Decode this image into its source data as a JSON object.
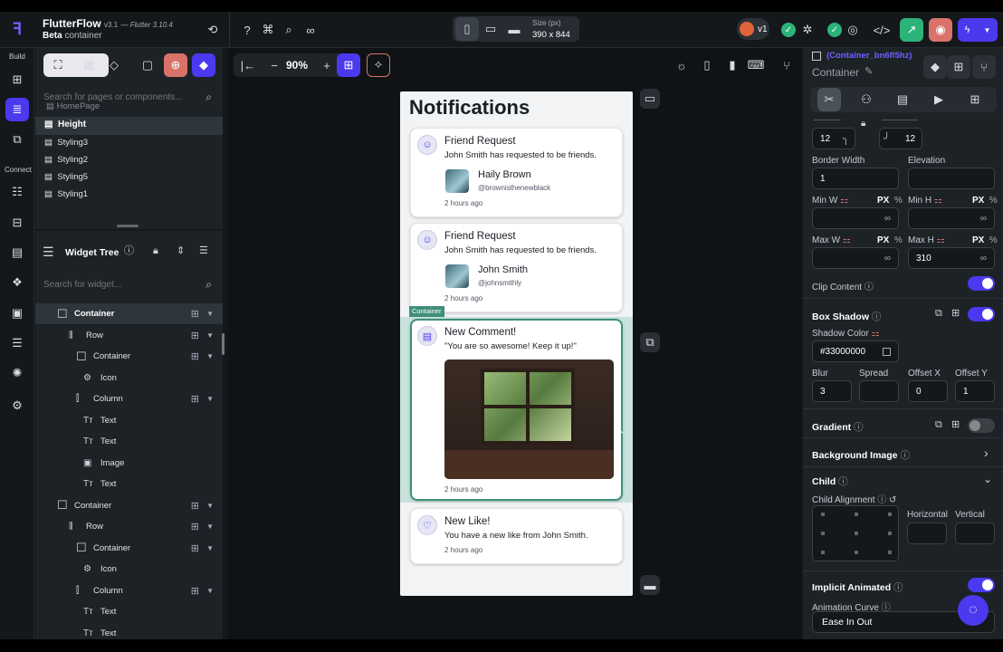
{
  "app": {
    "name": "FlutterFlow",
    "version": "v3.1",
    "flutter": "— Flutter 3.10.4",
    "channel": "Beta",
    "selected": "container"
  },
  "topbar": {
    "size_label": "Size (px)",
    "size_value": "390 x 844",
    "version_badge": "v1"
  },
  "rail": {
    "build_label": "Build",
    "connect_label": "Connect"
  },
  "leftpanel": {
    "search_pages_placeholder": "Search for pages or components...",
    "pages": [
      "HomePage",
      "Height",
      "Styling3",
      "Styling2",
      "Styling5",
      "Styling1"
    ],
    "widget_tree_title": "Widget Tree",
    "search_widget_placeholder": "Search for widget...",
    "tree": [
      {
        "label": "Container",
        "icon": "checkbox-icon",
        "indent": 0,
        "selected": true,
        "add": true,
        "caret": true
      },
      {
        "label": "Row",
        "icon": "row-icon",
        "indent": 1,
        "add": true,
        "caret": true
      },
      {
        "label": "Container",
        "icon": "checkbox-icon",
        "indent": 2,
        "add": true,
        "caret": true
      },
      {
        "label": "Icon",
        "icon": "gear-icon",
        "indent": 3,
        "add": false,
        "caret": false
      },
      {
        "label": "Column",
        "icon": "column-icon",
        "indent": 2,
        "add": true,
        "caret": true
      },
      {
        "label": "Text",
        "icon": "text-icon",
        "indent": 3,
        "add": false,
        "caret": false
      },
      {
        "label": "Text",
        "icon": "text-icon",
        "indent": 3,
        "add": false,
        "caret": false
      },
      {
        "label": "Image",
        "icon": "image-icon",
        "indent": 3,
        "add": false,
        "caret": false
      },
      {
        "label": "Text",
        "icon": "text-icon",
        "indent": 3,
        "add": false,
        "caret": false
      },
      {
        "label": "Container",
        "icon": "checkbox-icon",
        "indent": 0,
        "add": true,
        "caret": true
      },
      {
        "label": "Row",
        "icon": "row-icon",
        "indent": 1,
        "add": true,
        "caret": true
      },
      {
        "label": "Container",
        "icon": "checkbox-icon",
        "indent": 2,
        "add": true,
        "caret": true
      },
      {
        "label": "Icon",
        "icon": "gear-icon",
        "indent": 3,
        "add": false,
        "caret": false
      },
      {
        "label": "Column",
        "icon": "column-icon",
        "indent": 2,
        "add": true,
        "caret": true
      },
      {
        "label": "Text",
        "icon": "text-icon",
        "indent": 3,
        "add": false,
        "caret": false
      },
      {
        "label": "Text",
        "icon": "text-icon",
        "indent": 3,
        "add": false,
        "caret": false
      }
    ]
  },
  "canvas": {
    "zoom": "90%",
    "page_title": "Notifications",
    "selected_tag": "Container",
    "notifications": [
      {
        "title": "Friend Request",
        "message": "John Smith has requested to be friends.",
        "user_name": "Haily Brown",
        "user_handle": "@brownisthenewblack",
        "time": "2 hours ago",
        "icon": "person-add-icon"
      },
      {
        "title": "Friend Request",
        "message": "John Smith has requested to be friends.",
        "user_name": "John Smith",
        "user_handle": "@johnsmithly",
        "time": "2 hours ago",
        "icon": "person-add-icon"
      },
      {
        "title": "New Comment!",
        "message": "\"You are so awesome! Keep it up!\"",
        "time": "2 hours ago",
        "icon": "comment-icon"
      },
      {
        "title": "New Like!",
        "message": "You have a new like from John Smith.",
        "time": "2 hours ago",
        "icon": "heart-icon"
      }
    ]
  },
  "rightpanel": {
    "widget_id": "(Container_bn6fl5hz)",
    "widget_type": "Container",
    "radius_left": "12",
    "radius_right": "12",
    "border_width_label": "Border Width",
    "border_width": "1",
    "elevation_label": "Elevation",
    "min_w_label": "Min W",
    "min_h_label": "Min H",
    "max_w_label": "Max W",
    "max_h_label": "Max H",
    "unit_px": "PX",
    "unit_pct": "%",
    "infinity": "∞",
    "max_h_value": "310",
    "clip_content_label": "Clip Content",
    "box_shadow_label": "Box Shadow",
    "shadow_color_label": "Shadow Color",
    "shadow_color": "#33000000",
    "blur_label": "Blur",
    "blur": "3",
    "spread_label": "Spread",
    "offset_x_label": "Offset X",
    "offset_x": "0",
    "offset_y_label": "Offset Y",
    "offset_y": "1",
    "gradient_label": "Gradient",
    "background_image_label": "Background Image",
    "child_label": "Child",
    "child_alignment_label": "Child Alignment",
    "horizontal_label": "Horizontal",
    "vertical_label": "Vertical",
    "implicit_animated_label": "Implicit Animated",
    "animation_curve_label": "Animation Curve",
    "animation_curve": "Ease In Out"
  },
  "colors": {
    "accent": "#4b39ef",
    "selected_border": "#3f8f7a",
    "panel": "#1d2226",
    "link": "#6f61ff"
  }
}
